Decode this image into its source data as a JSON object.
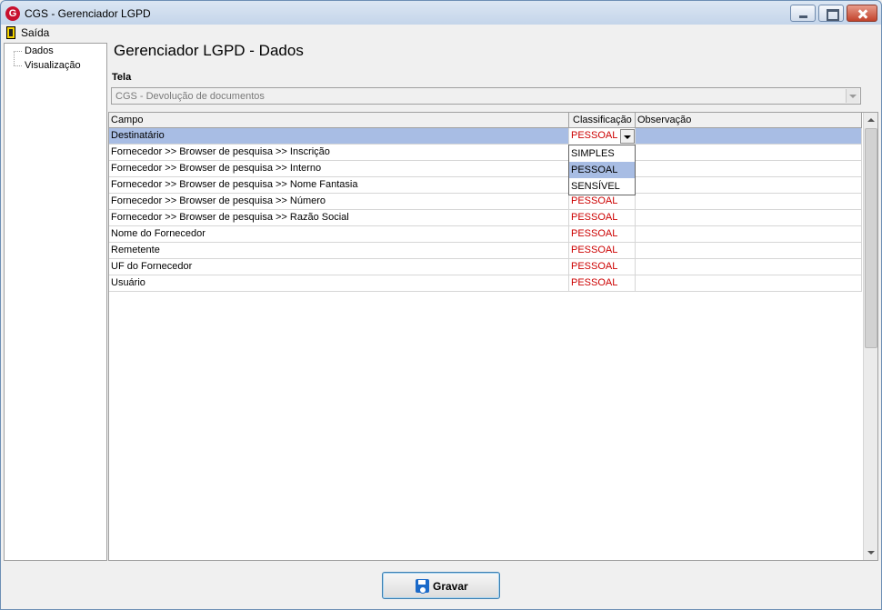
{
  "window": {
    "title": "CGS - Gerenciador LGPD",
    "app_icon_letter": "G"
  },
  "menu": {
    "items": [
      {
        "label": "Saída",
        "icon": "exit-door-icon"
      }
    ]
  },
  "tree": {
    "items": [
      {
        "label": "Dados"
      },
      {
        "label": "Visualização"
      }
    ]
  },
  "page": {
    "title": "Gerenciador LGPD - Dados"
  },
  "tela": {
    "label": "Tela",
    "value": "CGS - Devolução de documentos"
  },
  "grid": {
    "columns": [
      "Campo",
      "Classificação",
      "Observação"
    ],
    "rows": [
      {
        "campo": "Destinatário",
        "classificacao": "PESSOAL",
        "observacao": "",
        "selected": true
      },
      {
        "campo": "Fornecedor >> Browser de pesquisa >> Inscrição",
        "classificacao": "",
        "observacao": ""
      },
      {
        "campo": "Fornecedor >> Browser de pesquisa >> Interno",
        "classificacao": "",
        "observacao": ""
      },
      {
        "campo": "Fornecedor >> Browser de pesquisa >> Nome Fantasia",
        "classificacao": "",
        "observacao": ""
      },
      {
        "campo": "Fornecedor >> Browser de pesquisa >> Número",
        "classificacao": "PESSOAL",
        "observacao": ""
      },
      {
        "campo": "Fornecedor >> Browser de pesquisa >> Razão Social",
        "classificacao": "PESSOAL",
        "observacao": ""
      },
      {
        "campo": "Nome do Fornecedor",
        "classificacao": "PESSOAL",
        "observacao": ""
      },
      {
        "campo": "Remetente",
        "classificacao": "PESSOAL",
        "observacao": ""
      },
      {
        "campo": "UF do Fornecedor",
        "classificacao": "PESSOAL",
        "observacao": ""
      },
      {
        "campo": "Usuário",
        "classificacao": "PESSOAL",
        "observacao": ""
      }
    ],
    "dropdown_options": [
      "SIMPLES",
      "PESSOAL",
      "SENSÍVEL"
    ],
    "dropdown_selected": "PESSOAL"
  },
  "footer": {
    "save_label": "Gravar",
    "save_icon": "floppy-disk-icon"
  },
  "colors": {
    "selection": "#a8bde4",
    "classification_text": "#cc0000",
    "title_bar": "#c4d5ea"
  }
}
